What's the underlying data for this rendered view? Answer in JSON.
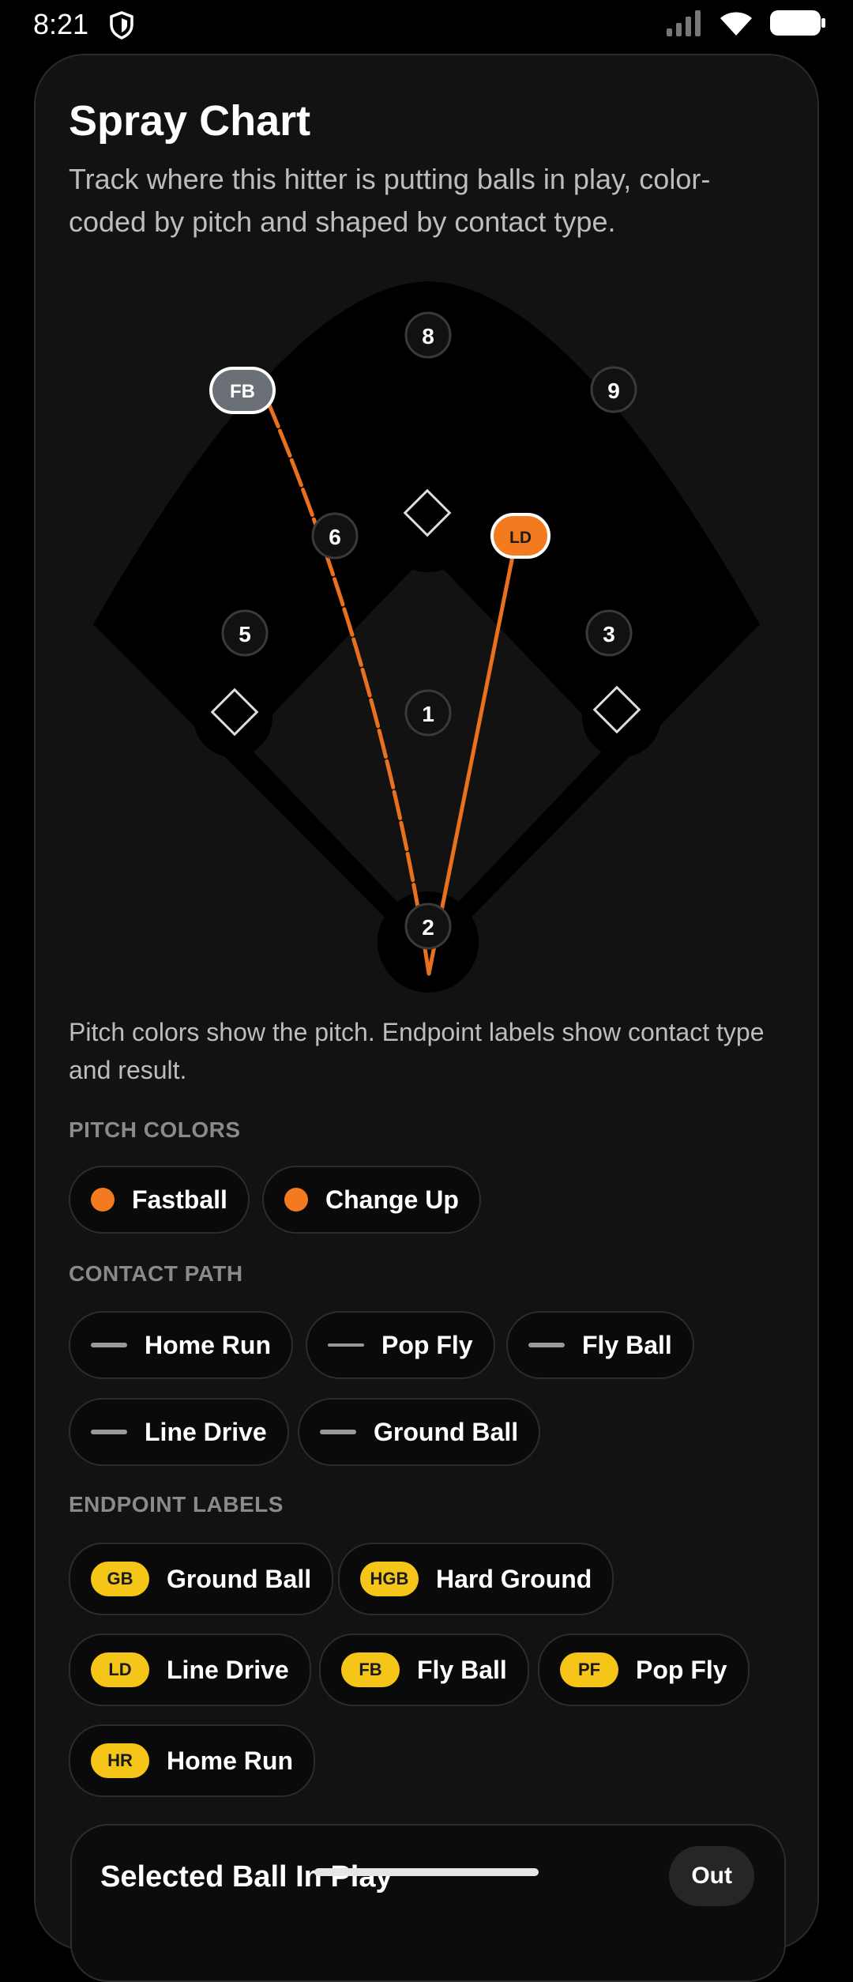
{
  "status_bar": {
    "time": "8:21"
  },
  "header": {
    "title": "Spray Chart",
    "subtitle": "Track where this hitter is putting balls in play, color-coded by pitch and shaped by contact type."
  },
  "field": {
    "positions": [
      "8",
      "9",
      "6",
      "5",
      "3",
      "1",
      "2"
    ],
    "balls": [
      {
        "label": "FB",
        "pitch": "Fastball",
        "color": "#6b6f76"
      },
      {
        "label": "LD",
        "pitch": "Change Up",
        "color": "#f47a1f"
      }
    ],
    "path_color": "#e8701e"
  },
  "note": "Pitch colors show the pitch. Endpoint labels show contact type and result.",
  "legend": {
    "pitch_colors_label": "PITCH COLORS",
    "pitch_colors": [
      {
        "label": "Fastball",
        "color": "#f47a1f"
      },
      {
        "label": "Change Up",
        "color": "#f47a1f"
      }
    ],
    "contact_path_label": "CONTACT PATH",
    "contact_paths": [
      {
        "label": "Home Run",
        "color": "#9a9a9a"
      },
      {
        "label": "Pop Fly",
        "color": "#9a9a9a"
      },
      {
        "label": "Fly Ball",
        "color": "#9a9a9a"
      },
      {
        "label": "Line Drive",
        "color": "#9a9a9a"
      },
      {
        "label": "Ground Ball",
        "color": "#9a9a9a"
      }
    ],
    "endpoint_labels_label": "ENDPOINT LABELS",
    "endpoint_labels": [
      {
        "code": "GB",
        "label": "Ground Ball"
      },
      {
        "code": "HGB",
        "label": "Hard Ground"
      },
      {
        "code": "LD",
        "label": "Line Drive"
      },
      {
        "code": "FB",
        "label": "Fly Ball"
      },
      {
        "code": "PF",
        "label": "Pop Fly"
      },
      {
        "code": "HR",
        "label": "Home Run"
      }
    ]
  },
  "selected": {
    "title": "Selected Ball In Play",
    "result": "Out"
  }
}
